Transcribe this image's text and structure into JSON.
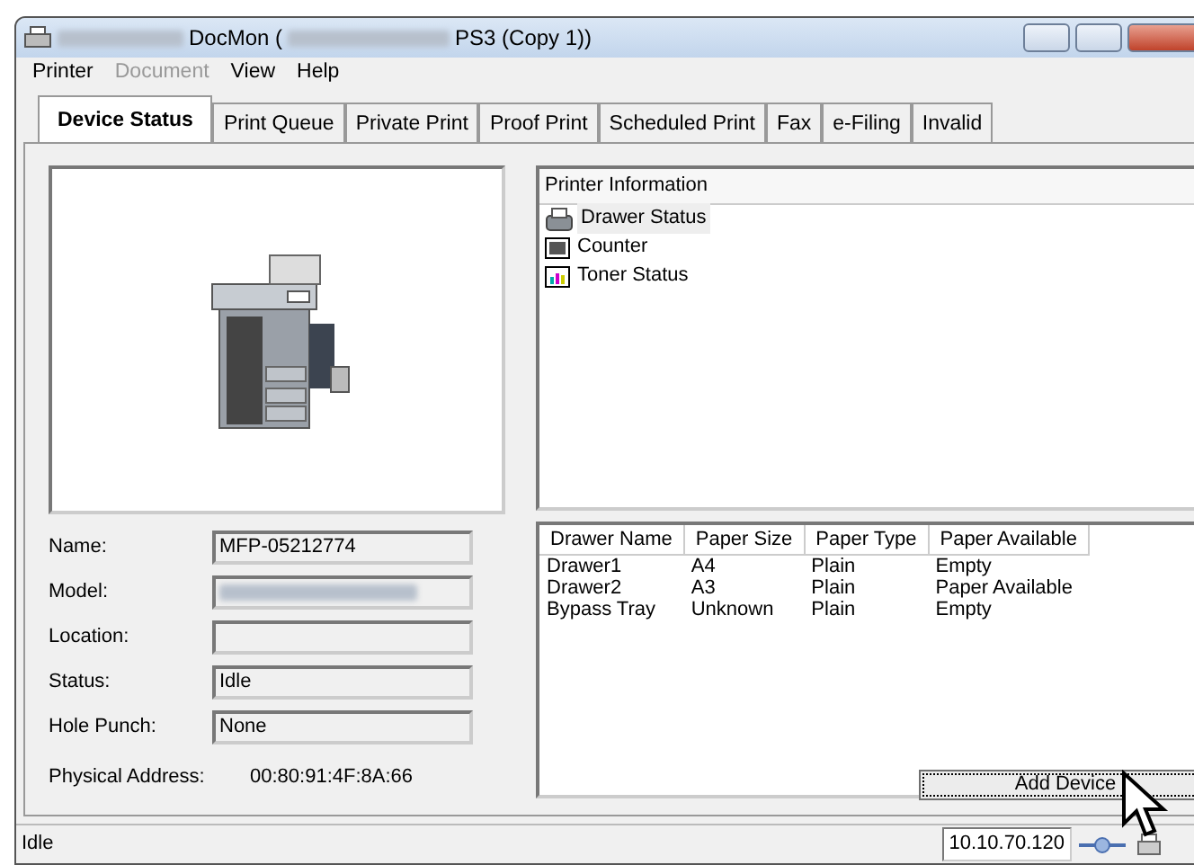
{
  "window": {
    "title_parts": [
      "DocMon (",
      "PS3 (Copy 1))"
    ]
  },
  "menu": [
    {
      "label": "Printer",
      "disabled": false
    },
    {
      "label": "Document",
      "disabled": true
    },
    {
      "label": "View",
      "disabled": false
    },
    {
      "label": "Help",
      "disabled": false
    }
  ],
  "tabs": [
    {
      "label": "Device Status",
      "selected": true
    },
    {
      "label": "Print Queue",
      "selected": false
    },
    {
      "label": "Private Print",
      "selected": false
    },
    {
      "label": "Proof Print",
      "selected": false
    },
    {
      "label": "Scheduled Print",
      "selected": false
    },
    {
      "label": "Fax",
      "selected": false
    },
    {
      "label": "e-Filing",
      "selected": false
    },
    {
      "label": "Invalid",
      "selected": false
    }
  ],
  "printer_information": {
    "header": "Printer Information",
    "items": [
      {
        "label": "Drawer Status",
        "kind": "drawer",
        "selected": true
      },
      {
        "label": "Counter",
        "kind": "counter",
        "selected": false
      },
      {
        "label": "Toner Status",
        "kind": "toner",
        "selected": false
      }
    ]
  },
  "fields": [
    {
      "label": "Name:",
      "value": "MFP-05212774",
      "kind": "text"
    },
    {
      "label": "Model:",
      "kind": "blurred"
    },
    {
      "label": "Location:",
      "kind": "text"
    },
    {
      "label": "Status:",
      "value": "Idle",
      "kind": "text"
    },
    {
      "label": "Hole Punch:",
      "value": "None",
      "kind": "text"
    }
  ],
  "physical_address": {
    "label": "Physical Address:",
    "value": "00:80:91:4F:8A:66"
  },
  "drawers": {
    "columns": [
      "Drawer Name",
      "Paper Size",
      "Paper Type",
      "Paper Available"
    ],
    "rows": [
      [
        "Drawer1",
        "A4",
        "Plain",
        "Empty"
      ],
      [
        "Drawer2",
        "A3",
        "Plain",
        "Paper Available"
      ],
      [
        "Bypass Tray",
        "Unknown",
        "Plain",
        "Empty"
      ]
    ]
  },
  "add_device_button": {
    "label": "Add Device",
    "focused": true
  },
  "status_bar": {
    "text": "Idle",
    "ip": "10.10.70.120"
  }
}
